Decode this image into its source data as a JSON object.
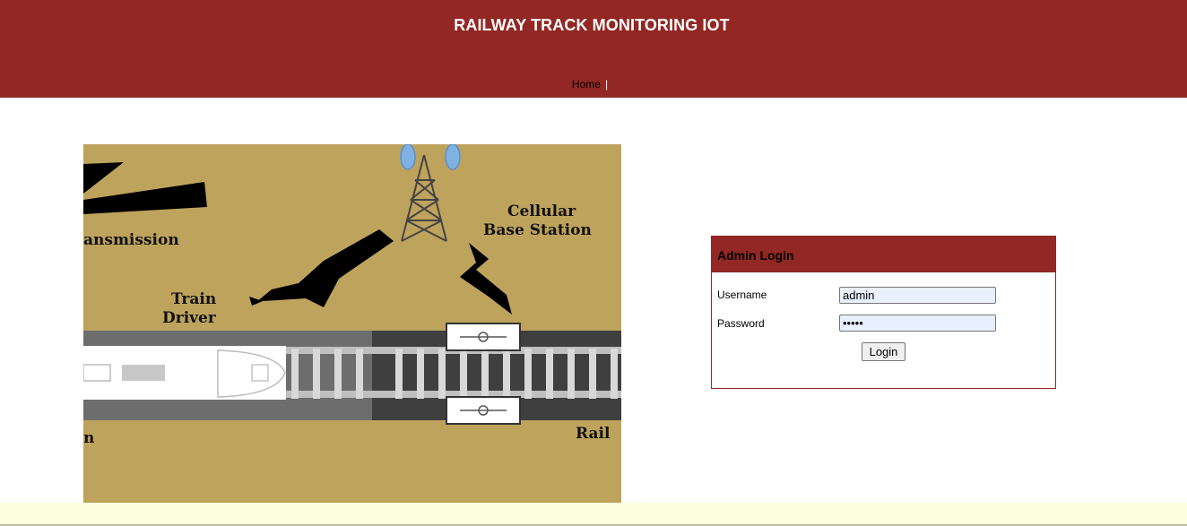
{
  "header": {
    "title": "RAILWAY TRACK MONITORING IOT",
    "nav": [
      {
        "label": "Home",
        "separator": "|"
      }
    ]
  },
  "illustration": {
    "labels": {
      "transmission": "ansmission",
      "cellular_line1": "Cellular",
      "cellular_line2": "Base Station",
      "train_line1": "Train",
      "train_line2": "Driver",
      "left_bottom": "n",
      "rail": "Rail"
    }
  },
  "login": {
    "heading": "Admin Login",
    "username_label": "Username",
    "username_value": "admin",
    "password_label": "Password",
    "password_value": "admin",
    "button_label": "Login"
  },
  "colors": {
    "brand": "#922724",
    "illustration_bg": "#bea35d",
    "footer_bg": "#fdfee0",
    "input_bg": "#e8f0fe"
  }
}
